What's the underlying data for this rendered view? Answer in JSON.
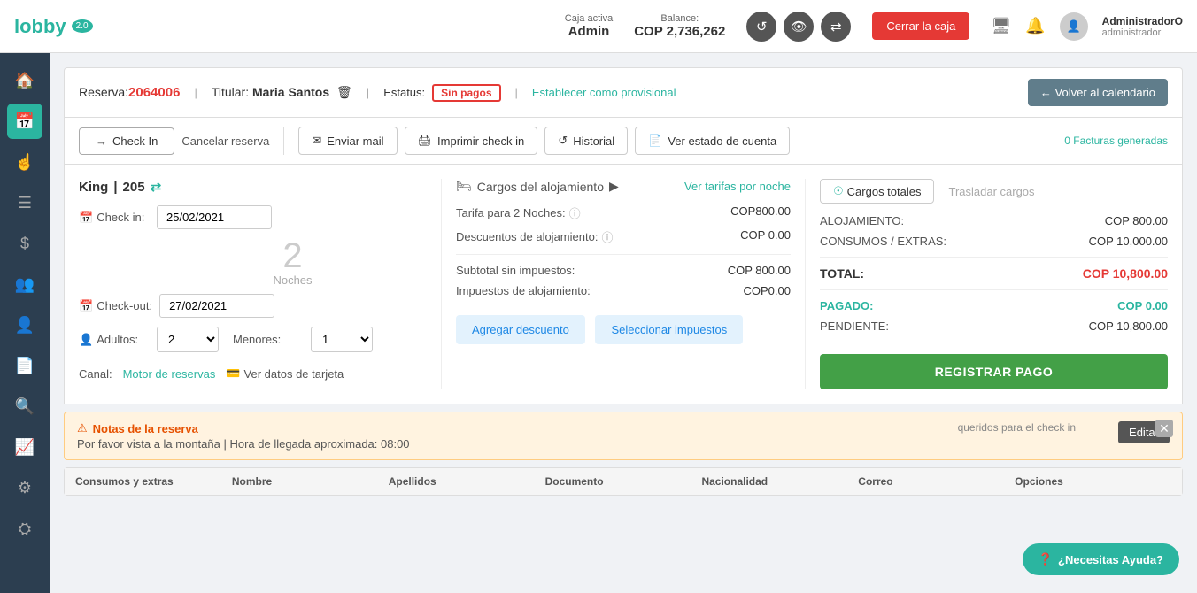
{
  "topbar": {
    "logo": "lobby",
    "logo_version": "2.0",
    "caja": {
      "label": "Caja activa",
      "value": "Admin"
    },
    "balance": {
      "label": "Balance:",
      "value": "COP 2,736,262"
    },
    "btn_cerrar": "Cerrar la caja",
    "user": {
      "name": "AdministradorO",
      "role": "administrador"
    }
  },
  "reservation": {
    "label": "Reserva:",
    "id": "2064006",
    "titular_label": "Titular:",
    "titular_name": "Maria Santos",
    "estatus_label": "Estatus:",
    "status": "Sin pagos",
    "btn_provisional": "Establecer como provisional",
    "btn_volver": "← Volver al calendario"
  },
  "actions": {
    "btn_checkin": "Check In",
    "btn_cancelar": "Cancelar reserva",
    "btn_enviar": "Enviar mail",
    "btn_imprimir": "Imprimir check in",
    "btn_historial": "Historial",
    "btn_estado": "Ver estado de cuenta",
    "facturas": "0 Facturas generadas"
  },
  "room": {
    "name": "King",
    "number": "205",
    "checkin_label": "Check in:",
    "checkin_value": "25/02/2021",
    "checkout_label": "Check-out:",
    "checkout_value": "27/02/2021",
    "noches": "2",
    "noches_label": "Noches",
    "adultos_label": "Adultos:",
    "adultos_value": "2",
    "menores_label": "Menores:",
    "menores_value": "1",
    "canal_label": "Canal:",
    "canal_value": "Motor de reservas",
    "tarjeta_label": "Ver datos de tarjeta"
  },
  "cargos": {
    "title": "Cargos del alojamiento",
    "tarifas_link": "Ver tarifas por noche",
    "tarifa_label": "Tarifa para 2 Noches:",
    "tarifa_value": "COP800.00",
    "descuento_label": "Descuentos de alojamiento:",
    "descuento_value": "COP 0.00",
    "subtotal_label": "Subtotal sin impuestos:",
    "subtotal_value": "COP 800.00",
    "impuestos_label": "Impuestos de alojamiento:",
    "impuestos_value": "COP0.00",
    "btn_descuento": "Agregar descuento",
    "btn_impuestos": "Seleccionar impuestos"
  },
  "totals": {
    "tab_active": "Cargos totales",
    "tab_traslado": "Trasladar cargos",
    "alojamiento_label": "ALOJAMIENTO:",
    "alojamiento_value": "COP 800.00",
    "consumos_label": "CONSUMOS / EXTRAS:",
    "consumos_value": "COP 10,000.00",
    "total_label": "TOTAL:",
    "total_value": "COP 10,800.00",
    "pagado_label": "PAGADO:",
    "pagado_value": "COP 0.00",
    "pendiente_label": "PENDIENTE:",
    "pendiente_value": "COP 10,800.00",
    "btn_registrar": "REGISTRAR PAGO"
  },
  "notes": {
    "title": "Notas de la reserva",
    "text": "Por favor vista a la montaña | Hora de llegada aproximada: 08:00",
    "btn_editar": "Editar",
    "checkin_note": "queridos para el check in"
  },
  "tabs": {
    "items": [
      "Consumos y extras",
      "Nombre",
      "Apellidos",
      "Documento",
      "Nacionalidad",
      "Correo",
      "Opciones"
    ]
  },
  "help": {
    "btn": "¿Necesitas Ayuda?"
  },
  "sidebar": {
    "icons": [
      "home",
      "calendar",
      "hand",
      "list",
      "dollar",
      "users",
      "id-card",
      "file",
      "search",
      "chart",
      "settings-alt",
      "settings"
    ]
  }
}
